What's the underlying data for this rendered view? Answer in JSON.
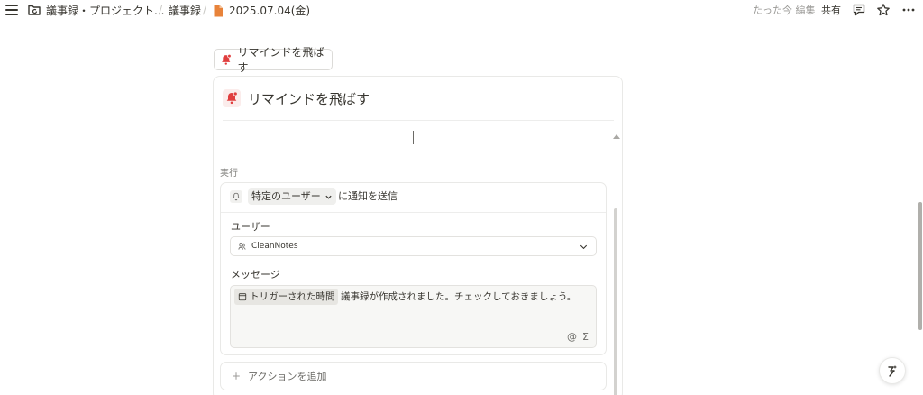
{
  "breadcrumb": {
    "workspace": "議事録・プロジェクト...",
    "database": "議事録",
    "page": "2025.07.04(金)"
  },
  "header": {
    "edited": "たった今 編集",
    "share_label": "共有"
  },
  "chip_button": {
    "label": "リマインドを飛ばす"
  },
  "panel": {
    "title": "リマインドを飛ばす",
    "section_label": "実行",
    "action": {
      "recipient_select": "特定のユーザー",
      "action_text": "に通知を送信",
      "user_label": "ユーザー",
      "user_value": "CleanNotes",
      "message_label": "メッセージ",
      "message_token": "トリガーされた時間",
      "message_text": "議事録が作成されました。チェックしておきましょう。",
      "mention_symbol": "@",
      "formula_symbol": "Σ"
    },
    "add_action_label": "アクションを追加"
  },
  "colors": {
    "accent_red": "#e03e3e",
    "file_orange": "#e8833a"
  }
}
